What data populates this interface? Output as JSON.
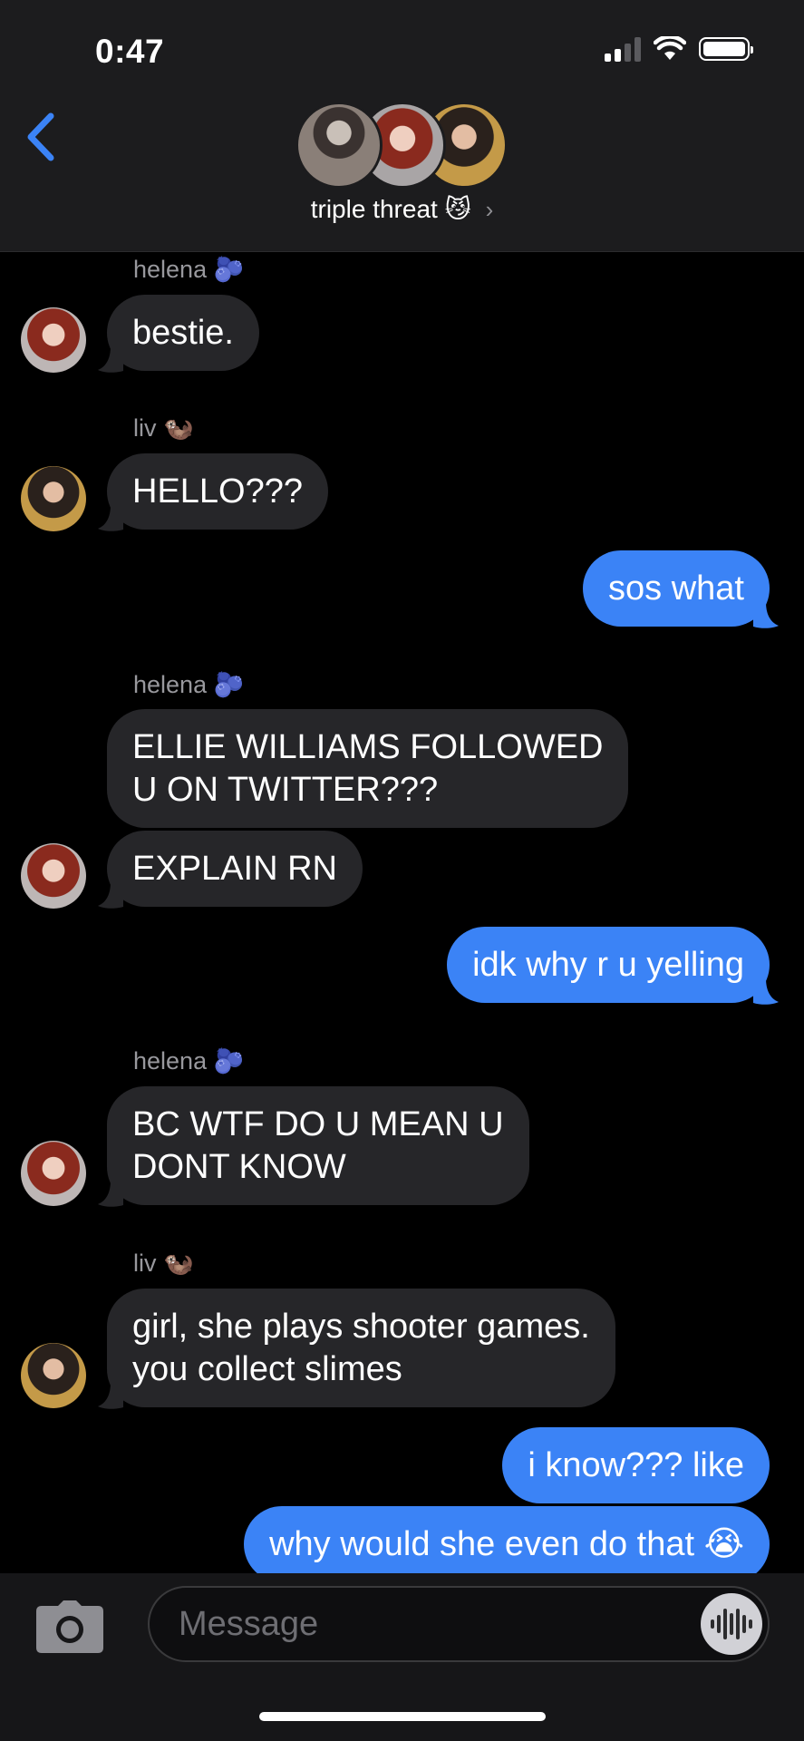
{
  "status_bar": {
    "time": "0:47"
  },
  "header": {
    "group_name": "triple threat",
    "group_emoji": "😼",
    "chevron": "›"
  },
  "messages": {
    "m1": {
      "sender": "helena",
      "sender_emoji": "🫐",
      "text": "bestie."
    },
    "m2": {
      "sender": "liv",
      "sender_emoji": "🦦",
      "text": "HELLO???"
    },
    "m3": {
      "text": "sos what"
    },
    "m4": {
      "sender": "helena",
      "sender_emoji": "🫐",
      "text": "ELLIE WILLIAMS FOLLOWED\nU ON TWITTER???"
    },
    "m5": {
      "text": "EXPLAIN RN"
    },
    "m6": {
      "text": "idk why r u yelling"
    },
    "m7": {
      "sender": "helena",
      "sender_emoji": "🫐",
      "text": "BC WTF DO U MEAN U\nDONT KNOW"
    },
    "m8": {
      "sender": "liv",
      "sender_emoji": "🦦",
      "text": "girl, she plays shooter games.\nyou collect slimes"
    },
    "m9": {
      "text": "i know??? like"
    },
    "m10": {
      "text": "why would she even do that 😭"
    }
  },
  "composer": {
    "placeholder": "Message"
  },
  "icons": {
    "back": "chevron-left-icon",
    "camera": "camera-icon",
    "audio": "waveform-icon",
    "signal": "signal-icon",
    "wifi": "wifi-icon",
    "battery": "battery-icon"
  },
  "colors": {
    "accent": "#3b83f6",
    "incoming_bubble": "#262629",
    "header_bg": "#1c1c1e",
    "background": "#000000"
  }
}
